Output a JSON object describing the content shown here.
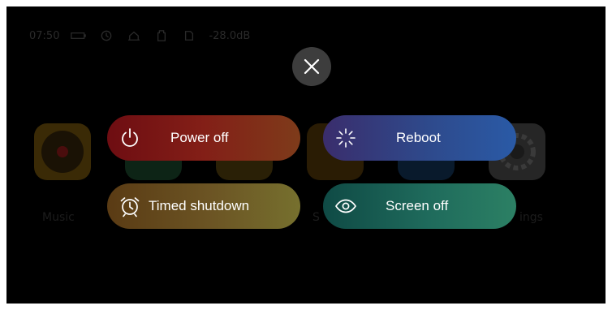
{
  "status_bar": {
    "time": "07:50",
    "signal": "-28.0dB",
    "icons": [
      "battery-icon",
      "clock-icon",
      "home-signal-icon",
      "sd-card-icon",
      "sim-icon"
    ]
  },
  "background_apps": [
    {
      "label": "Music",
      "icon": "music-app-icon",
      "color": "#3a2a06"
    },
    {
      "label": "",
      "icon": "photos-app-icon",
      "color": "#0d2416"
    },
    {
      "label": "",
      "icon": "folder-app-icon",
      "color": "#2a2006"
    },
    {
      "label": "S",
      "icon": "dark-app-icon",
      "color": "#2a1c04"
    },
    {
      "label": "",
      "icon": "blue-app-icon",
      "color": "#091a2c"
    },
    {
      "label": "ings",
      "icon": "settings-app-icon",
      "color": "#262626"
    }
  ],
  "close_button": {
    "icon": "close-icon"
  },
  "actions": {
    "power_off": {
      "label": "Power off",
      "icon": "power-icon"
    },
    "reboot": {
      "label": "Reboot",
      "icon": "reboot-icon"
    },
    "timed_shutdown": {
      "label": "Timed shutdown",
      "icon": "alarm-clock-icon"
    },
    "screen_off": {
      "label": "Screen off",
      "icon": "eye-icon"
    }
  },
  "colors": {
    "background": "#000000",
    "close_button_bg": "#3d3d3d",
    "power_off": "#7a1a16",
    "reboot": "#2e4a8c",
    "timed_shutdown": "#6a5222",
    "screen_off": "#1e6a5a"
  }
}
